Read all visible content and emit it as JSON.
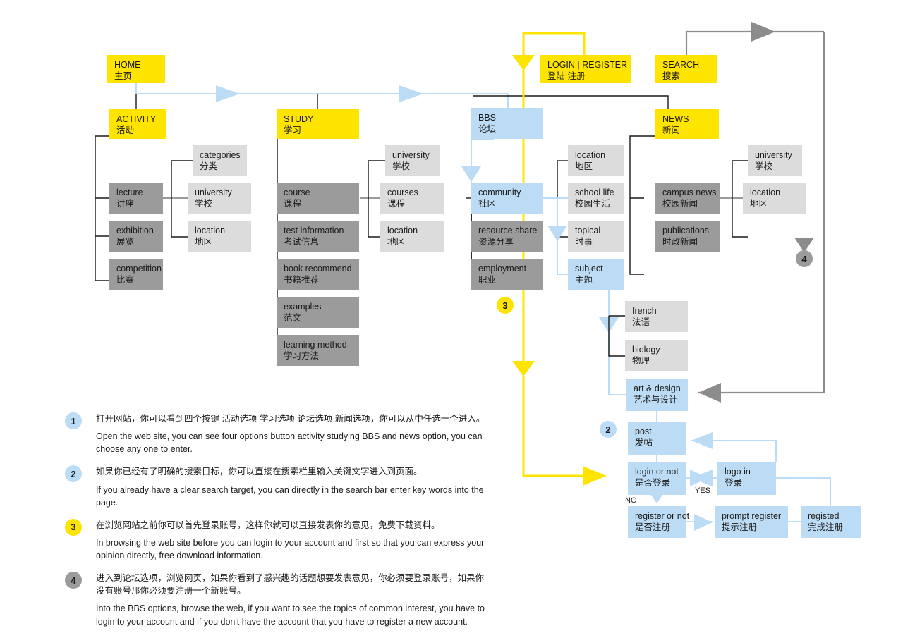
{
  "diagram": {
    "title": "Website Sitemap and User Flow",
    "colors": {
      "level1": "#ffe400",
      "level2": "#9b9b9b",
      "level3": "#dcdcdc",
      "flow": "#bcdcf5",
      "wire_black": "#1a1a1a",
      "wire_gray": "#8c8c8c",
      "wire_blue": "#bcdcf5",
      "wire_yellow": "#ffe400"
    }
  },
  "nodes": {
    "home": {
      "en": "HOME",
      "cn": "主页"
    },
    "login": {
      "en": "LOGIN | REGISTER",
      "cn": "登陆      注册"
    },
    "search": {
      "en": "SEARCH",
      "cn": "搜索"
    },
    "activity": {
      "en": "ACTIVITY",
      "cn": "活动"
    },
    "study": {
      "en": "STUDY",
      "cn": "学习"
    },
    "bbs": {
      "en": "BBS",
      "cn": "论坛"
    },
    "news": {
      "en": "NEWS",
      "cn": "新闻"
    },
    "lecture": {
      "en": "lecture",
      "cn": "讲座"
    },
    "exhibition": {
      "en": "exhibition",
      "cn": "展览"
    },
    "competition": {
      "en": "competition",
      "cn": "比赛"
    },
    "act_categories": {
      "en": "categories",
      "cn": "分类"
    },
    "act_university": {
      "en": "university",
      "cn": "学校"
    },
    "act_location": {
      "en": "location",
      "cn": "地区"
    },
    "course": {
      "en": "course",
      "cn": "课程"
    },
    "test_info": {
      "en": "test information",
      "cn": "考试信息"
    },
    "book_rec": {
      "en": "book recommend",
      "cn": "书籍推荐"
    },
    "examples": {
      "en": "examples",
      "cn": "范文"
    },
    "learn_method": {
      "en": "learning method",
      "cn": "学习方法"
    },
    "stu_university": {
      "en": "university",
      "cn": "学校"
    },
    "stu_courses": {
      "en": "courses",
      "cn": "课程"
    },
    "stu_location": {
      "en": "location",
      "cn": "地区"
    },
    "community": {
      "en": "community",
      "cn": "社区"
    },
    "resource_share": {
      "en": "resource share",
      "cn": "资源分享"
    },
    "employment": {
      "en": "employment",
      "cn": "职业"
    },
    "bbs_location": {
      "en": "location",
      "cn": "地区"
    },
    "school_life": {
      "en": "school life",
      "cn": "校园生活"
    },
    "topical": {
      "en": "topical",
      "cn": "时事"
    },
    "subject": {
      "en": "subject",
      "cn": "主题"
    },
    "campus_news": {
      "en": "campus news",
      "cn": "校园新闻"
    },
    "publications": {
      "en": "publications",
      "cn": "时政新闻"
    },
    "news_university": {
      "en": "university",
      "cn": "学校"
    },
    "news_location": {
      "en": "location",
      "cn": "地区"
    },
    "french": {
      "en": "french",
      "cn": "法语"
    },
    "biology": {
      "en": "biology",
      "cn": "物理"
    },
    "art_design": {
      "en": "art & design",
      "cn": "艺术与设计"
    },
    "post": {
      "en": "post",
      "cn": "发帖"
    },
    "login_or_not": {
      "en": "login or not",
      "cn": "是否登录"
    },
    "logo_in": {
      "en": "logo in",
      "cn": "登录"
    },
    "register_or_not": {
      "en": "register or not",
      "cn": "是否注册"
    },
    "prompt_register": {
      "en": "prompt register",
      "cn": "提示注册"
    },
    "registed": {
      "en": "registed",
      "cn": "完成注册"
    }
  },
  "edge_labels": {
    "yes": "YES",
    "no": "NO"
  },
  "badges": {
    "b1": "1",
    "b2": "2",
    "b3": "3",
    "b4": "4"
  },
  "legend": [
    {
      "num": "1",
      "style": "blue",
      "cn": "打开网站，你可以看到四个按键 活动选项 学习选项 论坛选项 新闻选项，你可以从中任选一个进入。",
      "en": "Open the web site, you can see four options button activity studying  BBS and news option, you can choose any one to enter."
    },
    {
      "num": "2",
      "style": "blue",
      "cn": "如果你已经有了明确的搜索目标，你可以直接在搜索栏里输入关键文字进入到页面。",
      "en": "If you already have a clear search target, you can directly in the search bar enter key words into the page."
    },
    {
      "num": "3",
      "style": "yellow",
      "cn": "在浏览网站之前你可以首先登录账号，这样你就可以直接发表你的意见，免费下载资料。",
      "en": "In browsing the web site before you can login to your account and first so that you can express your opinion directly, free download information."
    },
    {
      "num": "4",
      "style": "gray",
      "cn": "进入到论坛选项，浏览网页，如果你看到了感兴趣的话题想要发表意见，你必须要登录账号，如果你没有账号那你必须要注册一个新账号。",
      "en": "Into the BBS options, browse the web, if you want to see the topics of common interest, you have to login to your account and if you don't have the account that you have to register a new account."
    }
  ]
}
